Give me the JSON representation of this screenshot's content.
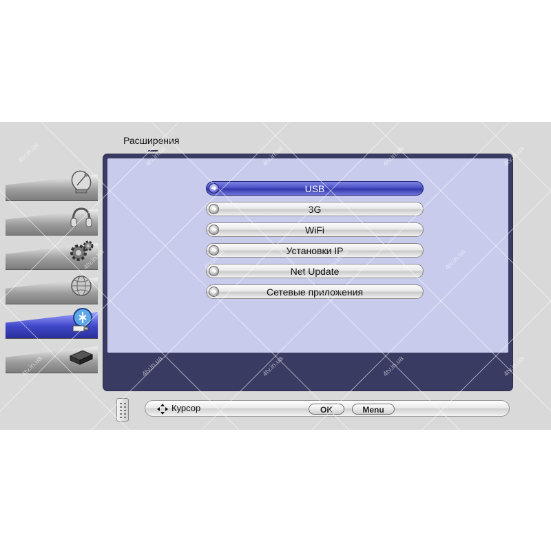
{
  "page": {
    "title": "Расширения"
  },
  "menu": {
    "items": [
      {
        "label": "USB",
        "selected": true
      },
      {
        "label": "3G"
      },
      {
        "label": "WiFi"
      },
      {
        "label": "Установки IP"
      },
      {
        "label": "Net Update"
      },
      {
        "label": "Сетевые приложения"
      }
    ]
  },
  "sidebar": {
    "tabs": [
      {
        "icon": "satellite-dish-icon"
      },
      {
        "icon": "headphones-icon"
      },
      {
        "icon": "gears-icon"
      },
      {
        "icon": "globe-icon"
      },
      {
        "icon": "usb-extensions-icon",
        "active": true
      },
      {
        "icon": "receiver-box-icon"
      }
    ]
  },
  "footer": {
    "cursor_label": "Курсор",
    "ok_label": "OK",
    "menu_label": "Menu"
  },
  "watermark": {
    "text": "4tv.in.ua"
  },
  "colors": {
    "accent": "#4c52c8",
    "panel": "#3a3b63",
    "panel_inner": "#c8cbec",
    "screen_bg": "#d9d9d9"
  }
}
